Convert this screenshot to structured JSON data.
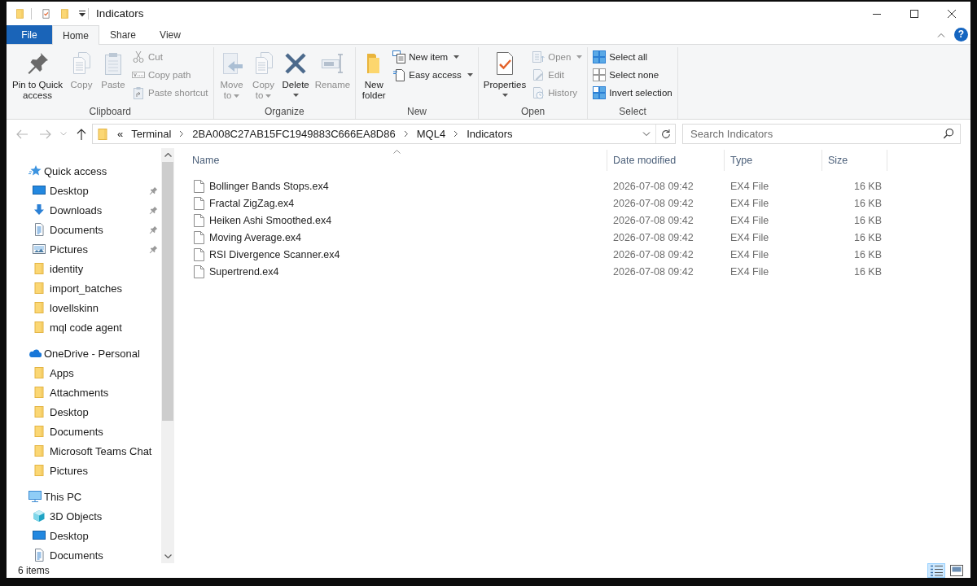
{
  "window": {
    "title": "Indicators"
  },
  "ribbon": {
    "tabs": [
      {
        "label": "File",
        "kind": "menu",
        "selected": false
      },
      {
        "label": "Home",
        "kind": "tab",
        "selected": true
      },
      {
        "label": "Share",
        "kind": "tab",
        "selected": false
      },
      {
        "label": "View",
        "kind": "tab",
        "selected": false
      }
    ],
    "help": "?",
    "groups": [
      {
        "label": "Clipboard",
        "commands": [
          {
            "label": "Pin to Quick\naccess",
            "kind": "large",
            "disabled": false,
            "dropdown": false
          },
          {
            "label": "Copy",
            "kind": "large",
            "disabled": true,
            "dropdown": false
          },
          {
            "label": "Paste",
            "kind": "large",
            "disabled": true,
            "dropdown": false
          },
          {
            "label": "Cut",
            "kind": "small",
            "disabled": true,
            "dropdown": false
          },
          {
            "label": "Copy path",
            "kind": "small",
            "disabled": true,
            "dropdown": false
          },
          {
            "label": "Paste shortcut",
            "kind": "small",
            "disabled": true,
            "dropdown": false
          }
        ]
      },
      {
        "label": "Organize",
        "commands": [
          {
            "label": "Move\nto",
            "kind": "large",
            "disabled": true,
            "dropdown": true
          },
          {
            "label": "Copy\nto",
            "kind": "large",
            "disabled": true,
            "dropdown": true
          },
          {
            "label": "Delete",
            "kind": "large",
            "disabled": false,
            "dropdown": true
          },
          {
            "label": "Rename",
            "kind": "large",
            "disabled": true,
            "dropdown": false
          }
        ]
      },
      {
        "label": "New",
        "commands": [
          {
            "label": "New\nfolder",
            "kind": "large",
            "disabled": false,
            "dropdown": false
          },
          {
            "label": "New item",
            "kind": "small",
            "disabled": false,
            "dropdown": true
          },
          {
            "label": "Easy access",
            "kind": "small",
            "disabled": false,
            "dropdown": true
          }
        ]
      },
      {
        "label": "Open",
        "commands": [
          {
            "label": "Properties",
            "kind": "large",
            "disabled": false,
            "dropdown": true
          },
          {
            "label": "Open",
            "kind": "small",
            "disabled": true,
            "dropdown": true
          },
          {
            "label": "Edit",
            "kind": "small",
            "disabled": true,
            "dropdown": false
          },
          {
            "label": "History",
            "kind": "small",
            "disabled": true,
            "dropdown": false
          }
        ]
      },
      {
        "label": "Select",
        "commands": [
          {
            "label": "Select all",
            "kind": "small",
            "disabled": false,
            "dropdown": false
          },
          {
            "label": "Select none",
            "kind": "small",
            "disabled": false,
            "dropdown": false
          },
          {
            "label": "Invert selection",
            "kind": "small",
            "disabled": false,
            "dropdown": false
          }
        ]
      }
    ]
  },
  "address": {
    "nav": [
      {
        "disabled": true
      },
      {
        "disabled": true
      },
      {
        "disabled": true
      },
      {
        "disabled": false
      }
    ],
    "overflow": "«",
    "crumbs": [
      "Terminal",
      "2BA008C27AB15FC1949883C666EA8D86",
      "MQL4",
      "Indicators"
    ]
  },
  "search": {
    "placeholder": "Search Indicators"
  },
  "sidebar": {
    "sections": [
      {
        "label": "Quick access",
        "children": [
          {
            "label": "Desktop",
            "pinned": true
          },
          {
            "label": "Downloads",
            "pinned": true
          },
          {
            "label": "Documents",
            "pinned": true
          },
          {
            "label": "Pictures",
            "pinned": true
          },
          {
            "label": "identity",
            "pinned": false
          },
          {
            "label": "import_batches",
            "pinned": false
          },
          {
            "label": "lovellskinn",
            "pinned": false
          },
          {
            "label": "mql code agent",
            "pinned": false
          }
        ]
      },
      {
        "label": "OneDrive - Personal",
        "children": [
          {
            "label": "Apps"
          },
          {
            "label": "Attachments"
          },
          {
            "label": "Desktop"
          },
          {
            "label": "Documents"
          },
          {
            "label": "Microsoft Teams Chat"
          },
          {
            "label": "Pictures"
          }
        ]
      },
      {
        "label": "This PC",
        "children": [
          {
            "label": "3D Objects"
          },
          {
            "label": "Desktop"
          },
          {
            "label": "Documents"
          }
        ]
      }
    ]
  },
  "table": {
    "columns": [
      {
        "label": "Name",
        "sorted": true
      },
      {
        "label": "Date modified",
        "sorted": false
      },
      {
        "label": "Type",
        "sorted": false
      },
      {
        "label": "Size",
        "sorted": false
      }
    ],
    "rows": [
      {
        "cells": [
          "Bollinger Bands Stops.ex4",
          "2026-07-08 09:42",
          "EX4 File",
          "16 KB"
        ],
        "selected": false
      },
      {
        "cells": [
          "Fractal ZigZag.ex4",
          "2026-07-08 09:42",
          "EX4 File",
          "16 KB"
        ],
        "selected": false
      },
      {
        "cells": [
          "Heiken Ashi Smoothed.ex4",
          "2026-07-08 09:42",
          "EX4 File",
          "16 KB"
        ],
        "selected": false
      },
      {
        "cells": [
          "Moving Average.ex4",
          "2026-07-08 09:42",
          "EX4 File",
          "16 KB"
        ],
        "selected": false
      },
      {
        "cells": [
          "RSI Divergence Scanner.ex4",
          "2026-07-08 09:42",
          "EX4 File",
          "16 KB"
        ],
        "selected": false
      },
      {
        "cells": [
          "Supertrend.ex4",
          "2026-07-08 09:42",
          "EX4 File",
          "16 KB"
        ],
        "selected": false
      }
    ]
  },
  "status_bar": {
    "count": "6 items",
    "views": [
      {
        "selected": true
      },
      {
        "selected": false
      }
    ]
  }
}
